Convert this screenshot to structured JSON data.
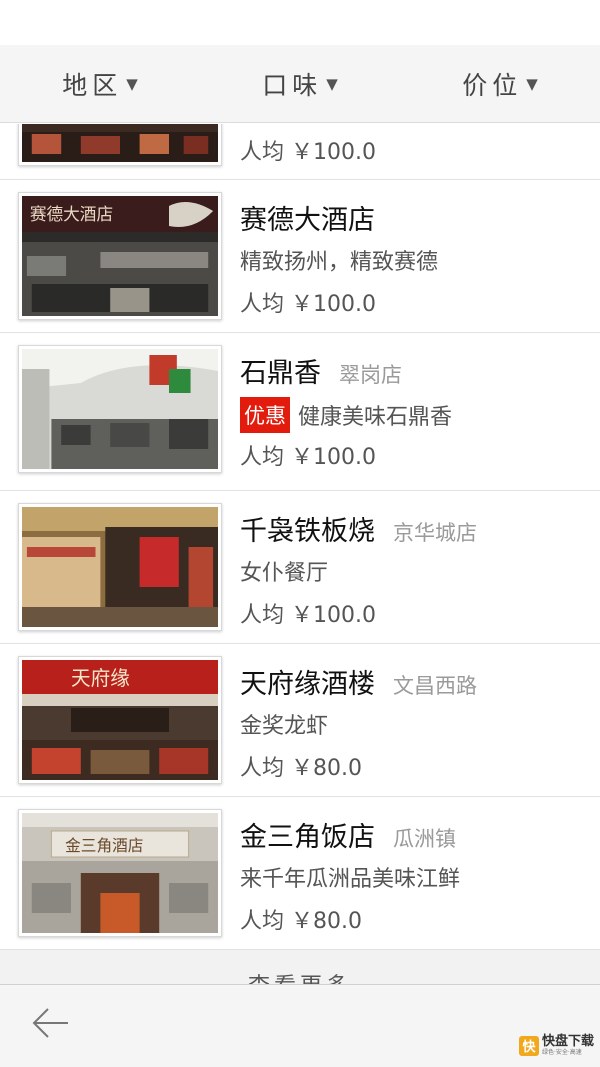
{
  "filters": [
    {
      "label": "地区",
      "arrow": "▼"
    },
    {
      "label": "口味",
      "arrow": "▼"
    },
    {
      "label": "价位",
      "arrow": "▼"
    }
  ],
  "partial_row": {
    "price": "人均 ￥100.0"
  },
  "restaurants": [
    {
      "name": "赛德大酒店",
      "branch": "",
      "promo": "",
      "desc": "精致扬州，精致赛德",
      "price": "人均 ￥100.0",
      "sign_text": "赛德大酒店"
    },
    {
      "name": "石鼎香",
      "branch": "翠岗店",
      "promo": "优惠",
      "desc": "健康美味石鼎香",
      "price": "人均 ￥100.0",
      "sign_text": ""
    },
    {
      "name": "千袅铁板烧",
      "branch": "京华城店",
      "promo": "",
      "desc": "女仆餐厅",
      "price": "人均 ￥100.0",
      "sign_text": ""
    },
    {
      "name": "天府缘酒楼",
      "branch": "文昌西路",
      "promo": "",
      "desc": "金奖龙虾",
      "price": "人均 ￥80.0",
      "sign_text": "天府缘"
    },
    {
      "name": "金三角饭店",
      "branch": "瓜洲镇",
      "promo": "",
      "desc": "来千年瓜洲品美味江鲜",
      "price": "人均 ￥80.0",
      "sign_text": "金三角酒店"
    }
  ],
  "more_label": "查看更多",
  "nav": {
    "back_icon": "arrow-left-icon"
  },
  "watermark": {
    "logo": "快",
    "title": "快盘下载",
    "sub": "绿色·安全·高速"
  },
  "colors": {
    "promo": "#e21b0c",
    "filter_bg": "#f5f5f5",
    "list_bg": "#f2f2f2"
  }
}
